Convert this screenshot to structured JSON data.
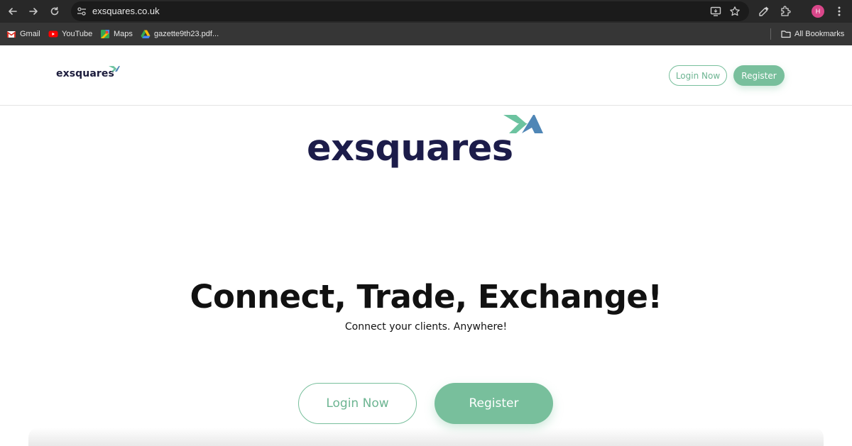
{
  "browser": {
    "url": "exsquares.co.uk",
    "avatar_initial": "H",
    "bookmarks": [
      {
        "label": "Gmail",
        "icon": "gmail-icon"
      },
      {
        "label": "YouTube",
        "icon": "youtube-icon"
      },
      {
        "label": "Maps",
        "icon": "maps-icon"
      },
      {
        "label": "gazette9th23.pdf...",
        "icon": "google-drive-icon"
      }
    ],
    "all_bookmarks_label": "All Bookmarks"
  },
  "header": {
    "logo_text": "exsquares",
    "login_label": "Login Now",
    "register_label": "Register"
  },
  "hero": {
    "logo_text": "exsquares",
    "title": "Connect, Trade, Exchange!",
    "subtitle": "Connect your clients. Anywhere!",
    "login_label": "Login Now",
    "register_label": "Register"
  },
  "colors": {
    "accent_green": "#78bf9c",
    "logo_navy": "#1c1c4a",
    "logo_mark_teal": "#6cc3a0",
    "logo_mark_blue": "#4f86b6"
  }
}
